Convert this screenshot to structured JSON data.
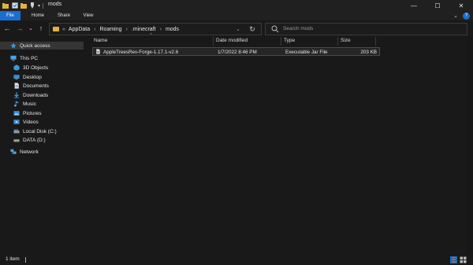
{
  "window": {
    "title": "mods",
    "minimize_glyph": "—",
    "maximize_glyph": "☐",
    "close_glyph": "✕"
  },
  "ribbon": {
    "tabs": [
      "File",
      "Home",
      "Share",
      "View"
    ],
    "chevron_glyph": "⌄",
    "help_glyph": "?"
  },
  "nav": {
    "back_glyph": "←",
    "forward_glyph": "→",
    "history_glyph": "⌄",
    "up_glyph": "↑"
  },
  "address": {
    "overflow": "«",
    "breadcrumbs": [
      "AppData",
      "Roaming",
      ".minecraft",
      "mods"
    ],
    "separator": "›",
    "dropdown_glyph": "⌄",
    "refresh_glyph": "↻"
  },
  "search": {
    "placeholder": "Search mods"
  },
  "sidebar": {
    "items": [
      {
        "label": "Quick access",
        "icon": "star-icon"
      },
      {
        "label": "This PC",
        "icon": "computer-icon"
      },
      {
        "label": "3D Objects",
        "icon": "cube-icon"
      },
      {
        "label": "Desktop",
        "icon": "desktop-icon"
      },
      {
        "label": "Documents",
        "icon": "document-icon"
      },
      {
        "label": "Downloads",
        "icon": "download-icon"
      },
      {
        "label": "Music",
        "icon": "music-icon"
      },
      {
        "label": "Pictures",
        "icon": "picture-icon"
      },
      {
        "label": "Videos",
        "icon": "video-icon"
      },
      {
        "label": "Local Disk (C:)",
        "icon": "drive-icon"
      },
      {
        "label": "DATA (D:)",
        "icon": "drive-icon"
      },
      {
        "label": "Network",
        "icon": "network-icon"
      }
    ]
  },
  "columns": {
    "name": "Name",
    "date": "Date modified",
    "type": "Type",
    "size": "Size",
    "sort_glyph": "^"
  },
  "files": [
    {
      "name": "AppleTreesRev-Forge-1.17.1-v2.6",
      "date": "1/7/2022 8:46 PM",
      "type": "Executable Jar File",
      "size": "203 KB"
    }
  ],
  "status": {
    "count": "1 item"
  },
  "colors": {
    "accent": "#1a6ecf",
    "folder": "#e3b23c",
    "background": "#191919"
  }
}
